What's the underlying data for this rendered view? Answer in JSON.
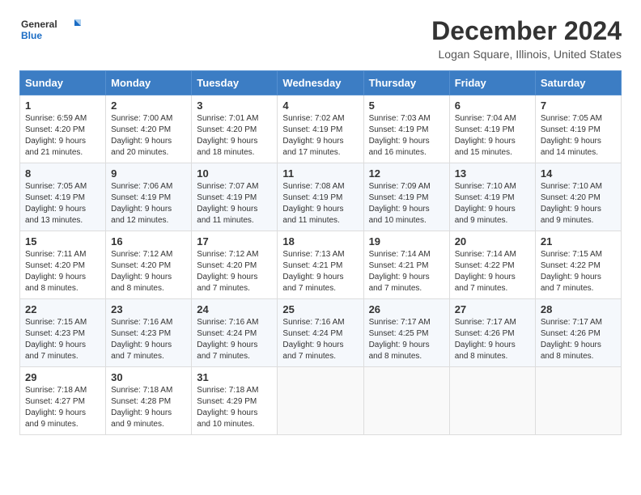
{
  "logo": {
    "line1": "General",
    "line2": "Blue"
  },
  "title": "December 2024",
  "location": "Logan Square, Illinois, United States",
  "days_header": [
    "Sunday",
    "Monday",
    "Tuesday",
    "Wednesday",
    "Thursday",
    "Friday",
    "Saturday"
  ],
  "weeks": [
    [
      {
        "day": "1",
        "sunrise": "6:59 AM",
        "sunset": "4:20 PM",
        "daylight": "9 hours and 21 minutes."
      },
      {
        "day": "2",
        "sunrise": "7:00 AM",
        "sunset": "4:20 PM",
        "daylight": "9 hours and 20 minutes."
      },
      {
        "day": "3",
        "sunrise": "7:01 AM",
        "sunset": "4:20 PM",
        "daylight": "9 hours and 18 minutes."
      },
      {
        "day": "4",
        "sunrise": "7:02 AM",
        "sunset": "4:19 PM",
        "daylight": "9 hours and 17 minutes."
      },
      {
        "day": "5",
        "sunrise": "7:03 AM",
        "sunset": "4:19 PM",
        "daylight": "9 hours and 16 minutes."
      },
      {
        "day": "6",
        "sunrise": "7:04 AM",
        "sunset": "4:19 PM",
        "daylight": "9 hours and 15 minutes."
      },
      {
        "day": "7",
        "sunrise": "7:05 AM",
        "sunset": "4:19 PM",
        "daylight": "9 hours and 14 minutes."
      }
    ],
    [
      {
        "day": "8",
        "sunrise": "7:05 AM",
        "sunset": "4:19 PM",
        "daylight": "9 hours and 13 minutes."
      },
      {
        "day": "9",
        "sunrise": "7:06 AM",
        "sunset": "4:19 PM",
        "daylight": "9 hours and 12 minutes."
      },
      {
        "day": "10",
        "sunrise": "7:07 AM",
        "sunset": "4:19 PM",
        "daylight": "9 hours and 11 minutes."
      },
      {
        "day": "11",
        "sunrise": "7:08 AM",
        "sunset": "4:19 PM",
        "daylight": "9 hours and 11 minutes."
      },
      {
        "day": "12",
        "sunrise": "7:09 AM",
        "sunset": "4:19 PM",
        "daylight": "9 hours and 10 minutes."
      },
      {
        "day": "13",
        "sunrise": "7:10 AM",
        "sunset": "4:19 PM",
        "daylight": "9 hours and 9 minutes."
      },
      {
        "day": "14",
        "sunrise": "7:10 AM",
        "sunset": "4:20 PM",
        "daylight": "9 hours and 9 minutes."
      }
    ],
    [
      {
        "day": "15",
        "sunrise": "7:11 AM",
        "sunset": "4:20 PM",
        "daylight": "9 hours and 8 minutes."
      },
      {
        "day": "16",
        "sunrise": "7:12 AM",
        "sunset": "4:20 PM",
        "daylight": "9 hours and 8 minutes."
      },
      {
        "day": "17",
        "sunrise": "7:12 AM",
        "sunset": "4:20 PM",
        "daylight": "9 hours and 7 minutes."
      },
      {
        "day": "18",
        "sunrise": "7:13 AM",
        "sunset": "4:21 PM",
        "daylight": "9 hours and 7 minutes."
      },
      {
        "day": "19",
        "sunrise": "7:14 AM",
        "sunset": "4:21 PM",
        "daylight": "9 hours and 7 minutes."
      },
      {
        "day": "20",
        "sunrise": "7:14 AM",
        "sunset": "4:22 PM",
        "daylight": "9 hours and 7 minutes."
      },
      {
        "day": "21",
        "sunrise": "7:15 AM",
        "sunset": "4:22 PM",
        "daylight": "9 hours and 7 minutes."
      }
    ],
    [
      {
        "day": "22",
        "sunrise": "7:15 AM",
        "sunset": "4:23 PM",
        "daylight": "9 hours and 7 minutes."
      },
      {
        "day": "23",
        "sunrise": "7:16 AM",
        "sunset": "4:23 PM",
        "daylight": "9 hours and 7 minutes."
      },
      {
        "day": "24",
        "sunrise": "7:16 AM",
        "sunset": "4:24 PM",
        "daylight": "9 hours and 7 minutes."
      },
      {
        "day": "25",
        "sunrise": "7:16 AM",
        "sunset": "4:24 PM",
        "daylight": "9 hours and 7 minutes."
      },
      {
        "day": "26",
        "sunrise": "7:17 AM",
        "sunset": "4:25 PM",
        "daylight": "9 hours and 8 minutes."
      },
      {
        "day": "27",
        "sunrise": "7:17 AM",
        "sunset": "4:26 PM",
        "daylight": "9 hours and 8 minutes."
      },
      {
        "day": "28",
        "sunrise": "7:17 AM",
        "sunset": "4:26 PM",
        "daylight": "9 hours and 8 minutes."
      }
    ],
    [
      {
        "day": "29",
        "sunrise": "7:18 AM",
        "sunset": "4:27 PM",
        "daylight": "9 hours and 9 minutes."
      },
      {
        "day": "30",
        "sunrise": "7:18 AM",
        "sunset": "4:28 PM",
        "daylight": "9 hours and 9 minutes."
      },
      {
        "day": "31",
        "sunrise": "7:18 AM",
        "sunset": "4:29 PM",
        "daylight": "9 hours and 10 minutes."
      },
      null,
      null,
      null,
      null
    ]
  ]
}
